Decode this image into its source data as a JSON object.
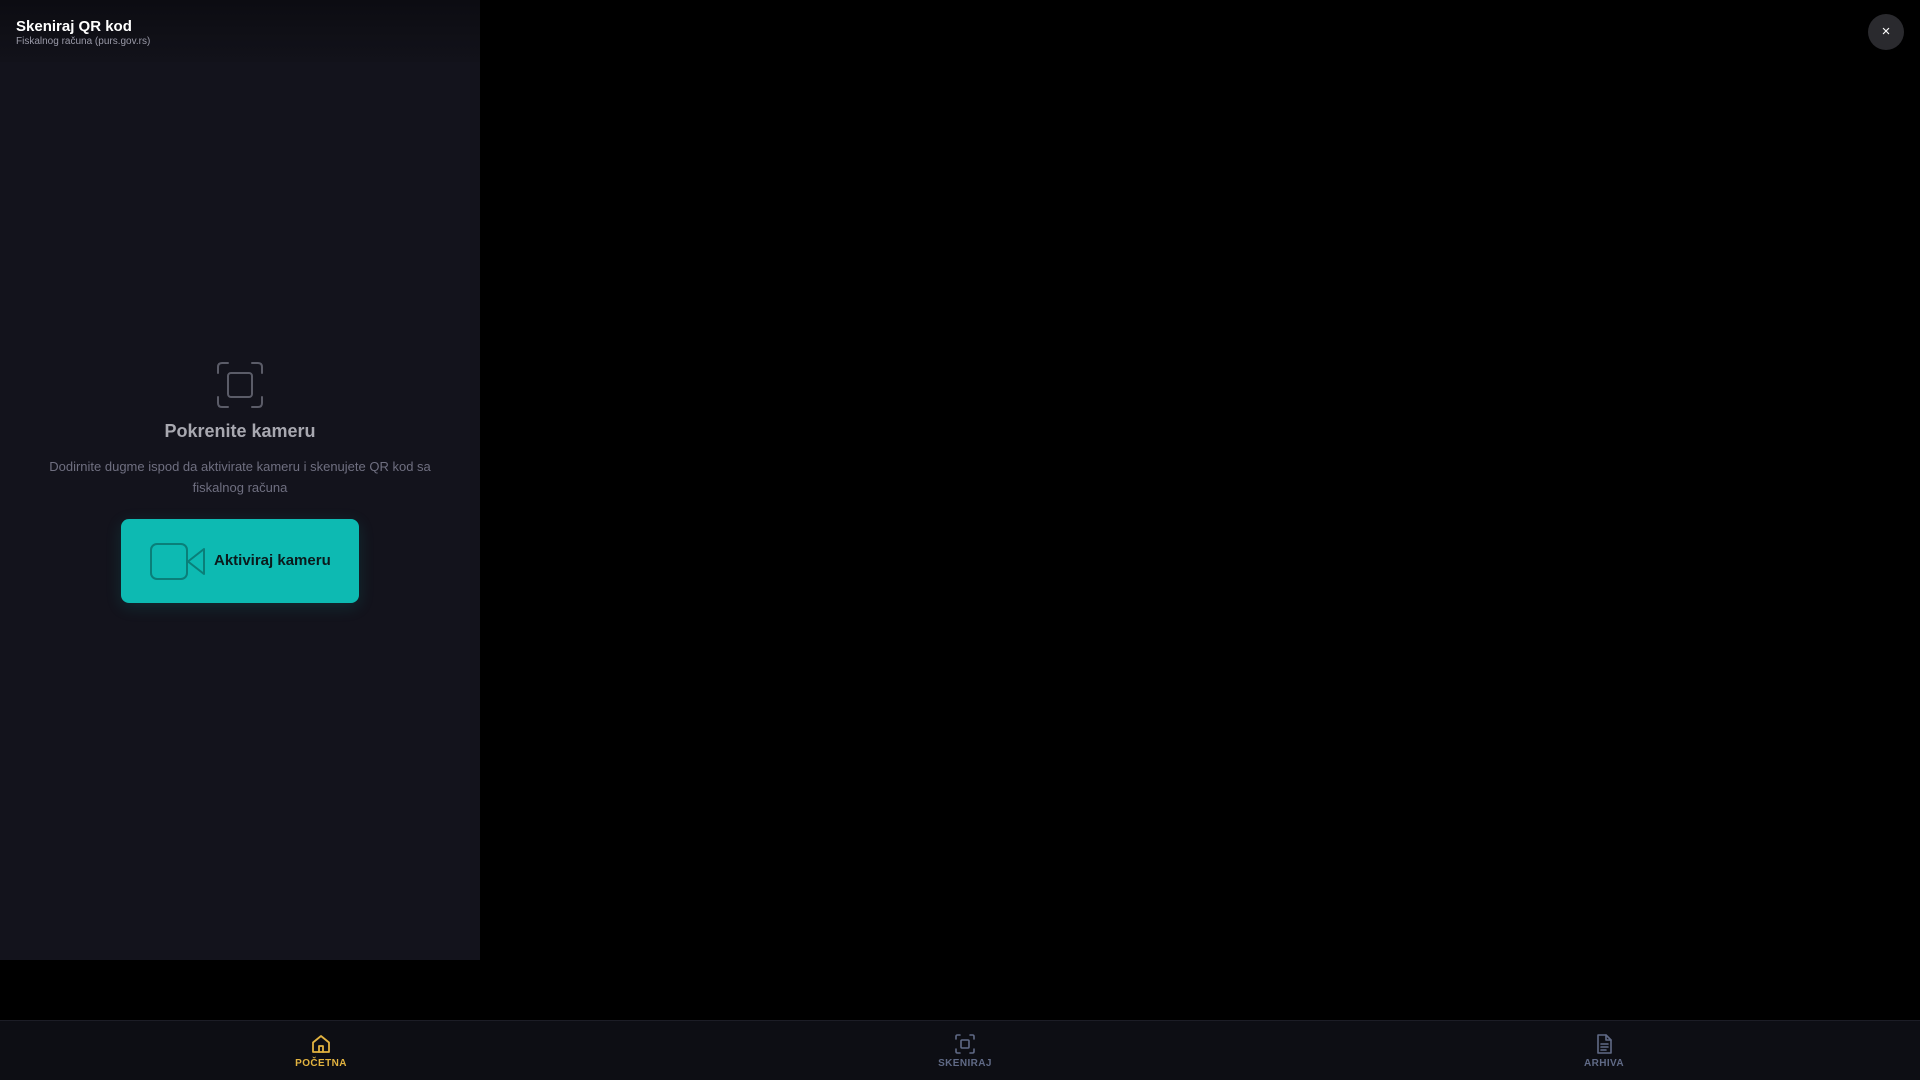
{
  "header": {
    "title": "Skeniraj QR kod",
    "subtitle": "Fiskalnog računa (purs.gov.rs)"
  },
  "close_button": {
    "label": "×",
    "icon": "close-icon"
  },
  "empty_state": {
    "icon": "scan-frame-icon",
    "title": "Pokrenite kameru",
    "description": "Dodirnite dugme ispod da aktivirate kameru i skenujete QR kod sa fiskalnog računa"
  },
  "activate_button": {
    "label": "Aktiviraj kameru",
    "icon": "video-camera-icon"
  },
  "bottom_nav": {
    "items": [
      {
        "label": "POČETNA",
        "icon": "home-icon",
        "active": true
      },
      {
        "label": "SKENIRAJ",
        "icon": "scan-icon",
        "active": false
      },
      {
        "label": "ARHIVA",
        "icon": "document-icon",
        "active": false
      }
    ]
  },
  "colors": {
    "accent": "#0dbab2",
    "nav_active": "#e2b340",
    "nav_inactive": "#606a86",
    "panel_bg": "#13131c",
    "page_bg": "#000000"
  }
}
